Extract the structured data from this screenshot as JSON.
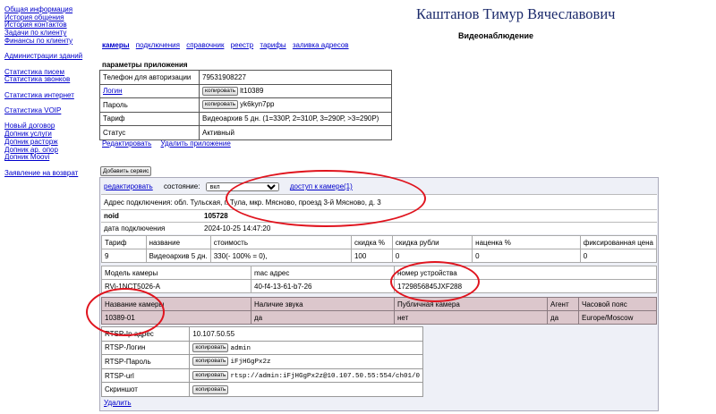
{
  "sidebar": {
    "groups": [
      [
        "Общая информация",
        "История общения",
        "История контактов",
        "Задачи по клиенту",
        "Финансы по клиенту"
      ],
      [
        "Администрации зданий"
      ],
      [
        "Статистика писем",
        "Статистика звонков"
      ],
      [
        "Статистика интернет"
      ],
      [
        "Статистика VOIP"
      ],
      [
        "Новый договор",
        "Допник услуги",
        "Допник расторж",
        "Допник ар. опор",
        "Допник Moovi"
      ],
      [
        "Заявление на возврат"
      ]
    ]
  },
  "header": {
    "user_name": "Каштанов Тимур Вячеславович",
    "section_title": "Видеонаблюдение"
  },
  "tabs": [
    "камеры",
    "подключения",
    "справочник",
    "реестр",
    "тарифы",
    "заливка адресов"
  ],
  "app_params": {
    "title": "параметры приложения",
    "phone_label": "Телефон для авторизации",
    "phone_value": "79531908227",
    "login_label": "Логин",
    "login_value": "lt10389",
    "password_label": "Пароль",
    "password_value": "yk6kyn7pp",
    "tariff_label": "Тариф",
    "tariff_value": "Видеоархив 5 дн. (1=330Р, 2=310Р, 3=290Р, >3=290Р)",
    "status_label": "Статус",
    "status_value": "Активный",
    "copy_label": "копировать",
    "edit_app": "Редактировать",
    "delete_app": "Удалить приложение"
  },
  "add_service": "Добавить сервис",
  "service": {
    "edit_link": "редактировать",
    "state_label": "состояние:",
    "state_value": "вкл",
    "camera_access": "доступ к камере(1)",
    "address": "Адрес подключения: обл. Тульская, г. Тула, мкр. Мясново, проезд 3-й Мясново, д. 3",
    "noid_label": "noid",
    "noid_value": "105728",
    "date_label": "дата подключения",
    "date_value": "2024-10-25 14:47:20",
    "tariff_headers": [
      "Тариф",
      "название",
      "стоимость",
      "скидка %",
      "скидка рубли",
      "наценка %",
      "фиксированная цена"
    ],
    "tariff_row": [
      "9",
      "Видеоархив 5 дн.",
      "330(- 100% = 0),",
      "100",
      "0",
      "0",
      "0"
    ],
    "camera_headers": [
      "Модель камеры",
      "mac адрес",
      "номер устройства"
    ],
    "camera_row": [
      "RVi-1NCT5026-A",
      "40-f4-13-61-b7-26",
      "1729856845JXF288"
    ],
    "cam2_headers": [
      "Название камеры",
      "Наличие звука",
      "Публичная камера",
      "Агент",
      "Часовой пояс"
    ],
    "cam2_row": [
      "10389-01",
      "да",
      "нет",
      "да",
      "Europe/Moscow"
    ],
    "rtsp_ip_label": "RTSP-Ip адрес",
    "rtsp_ip_value": "10.107.50.55",
    "rtsp_login_label": "RTSP-Логин",
    "rtsp_login_value": "admin",
    "rtsp_pass_label": "RTSP-Пароль",
    "rtsp_pass_value": "iFjHGgPx2z",
    "rtsp_url_label": "RTSP-url",
    "rtsp_url_value": "rtsp://admin:iFjHGgPx2z@10.107.50.55:554/ch01/0",
    "screenshot_label": "Скриншот",
    "copy_label": "копировать",
    "delete_link": "Удалить"
  },
  "colors": {
    "link": "#0000cc",
    "title": "#1b2a6b",
    "highlight_row": "#dcc7cc",
    "annotation": "#e0141e"
  }
}
